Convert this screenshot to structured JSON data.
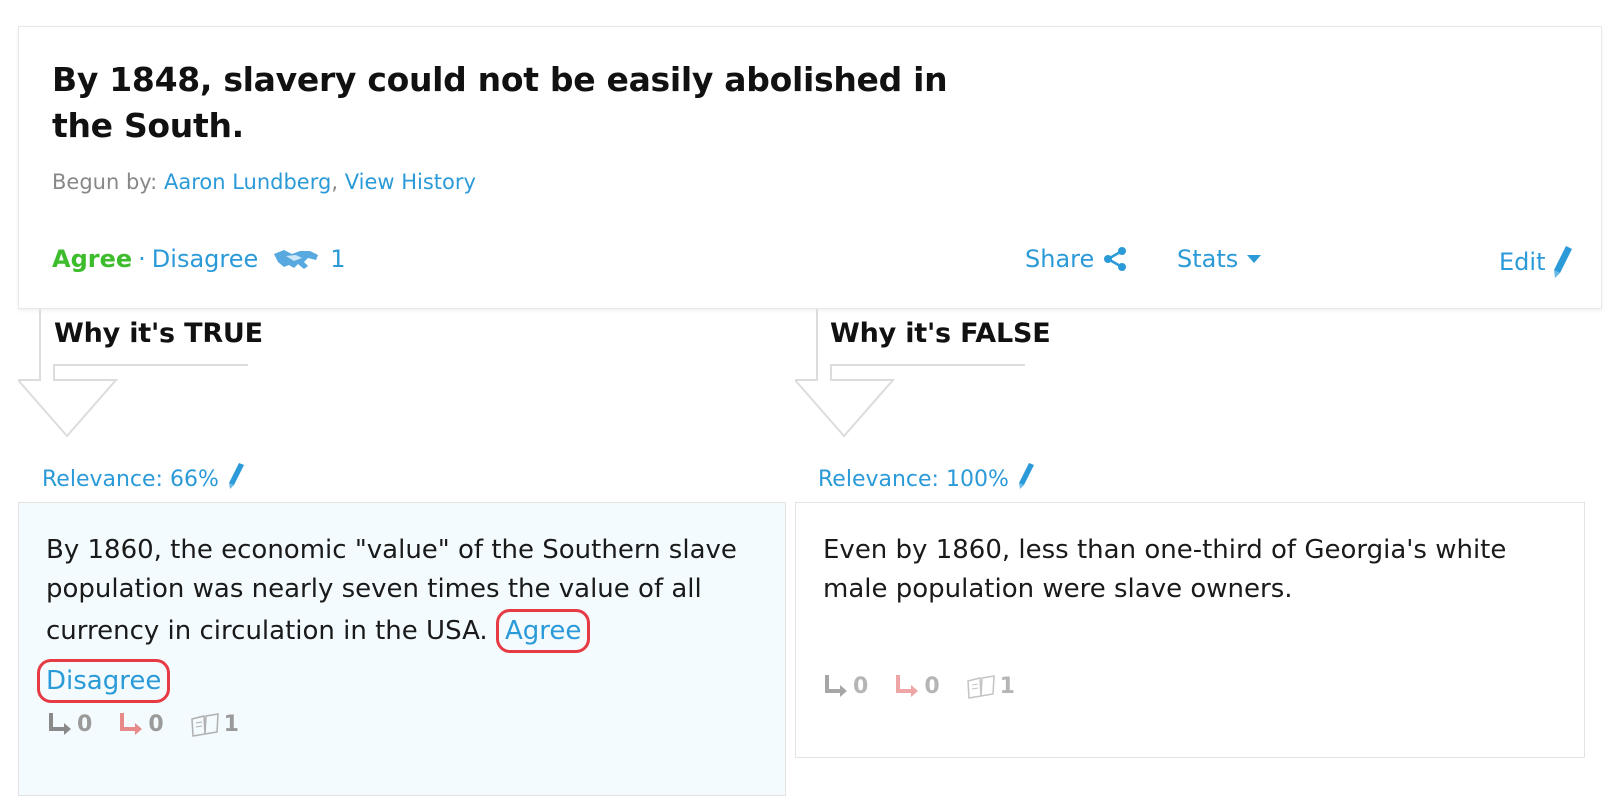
{
  "claim": {
    "title": "By 1848, slavery could not be easily abolished in the South.",
    "begun_by_label": "Begun by:",
    "author": "Aaron Lundberg",
    "separator": ",",
    "history_link": "View History",
    "agree": "Agree",
    "dot": "·",
    "disagree": "Disagree",
    "agree_count": "1",
    "share": "Share",
    "stats": "Stats",
    "edit": "Edit"
  },
  "pro": {
    "heading": "Why it's TRUE",
    "relevance": "Relevance: 66%",
    "text": "By 1860, the economic \"value\" of the Southern slave population was nearly seven times the value of all currency in circulation in the USA.",
    "agree": "Agree",
    "disagree": "Disagree",
    "support_count": "0",
    "oppose_count": "0",
    "source_count": "1"
  },
  "con": {
    "heading": "Why it's FALSE",
    "relevance": "Relevance: 100%",
    "text": "Even by 1860, less than one-third of Georgia's white male population were slave owners.",
    "support_count": "0",
    "oppose_count": "0",
    "source_count": "1"
  },
  "colors": {
    "link": "#2b9ad8",
    "agree": "#3dbd2c",
    "highlight_ring": "#e63b44",
    "oppose_arrow": "#e88a8a",
    "muted": "#9a9a9a"
  }
}
